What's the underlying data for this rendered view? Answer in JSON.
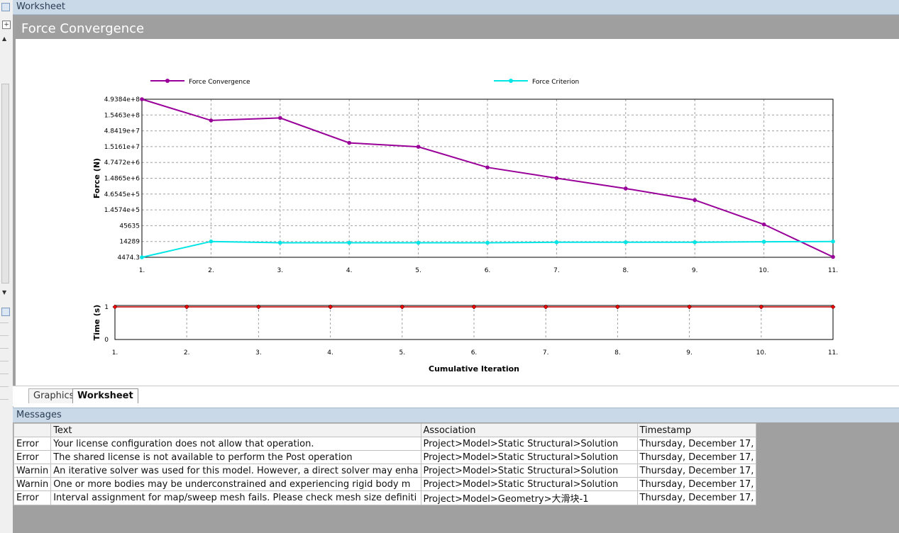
{
  "window": {
    "title": "Worksheet"
  },
  "worksheet": {
    "header": "Force Convergence"
  },
  "chart_data": [
    {
      "type": "line",
      "ylabel": "Force (N)",
      "yscale": "log",
      "y_tick_labels": [
        "4.9384e+8",
        "1.5463e+8",
        "4.8419e+7",
        "1.5161e+7",
        "4.7472e+6",
        "1.4865e+6",
        "4.6545e+5",
        "1.4574e+5",
        "45635",
        "14289",
        "4474.3"
      ],
      "y_ticks": [
        493840000,
        154630000,
        48419000,
        15161000,
        4747200,
        1486500,
        465450,
        145740,
        45635,
        14289,
        4474.3
      ],
      "x": [
        1,
        2,
        3,
        4,
        5,
        6,
        7,
        8,
        9,
        10,
        11
      ],
      "x_tick_labels": [
        "1.",
        "2.",
        "3.",
        "4.",
        "5.",
        "6.",
        "7.",
        "8.",
        "9.",
        "10.",
        "11."
      ],
      "series": [
        {
          "name": "Force Convergence",
          "color": "#990099",
          "values": [
            493840000,
            104000000,
            125000000,
            20000000,
            15000000,
            3300000,
            1500000,
            700000,
            300000,
            50000,
            4600
          ]
        },
        {
          "name": "Force Criterion",
          "color": "#00e5e5",
          "values": [
            4474.3,
            14289,
            13000,
            13000,
            13000,
            13000,
            13500,
            13500,
            13500,
            14000,
            14289
          ]
        }
      ],
      "legend": "top",
      "grid": true
    },
    {
      "type": "line",
      "ylabel": "Time (s)",
      "xlabel": "Cumulative Iteration",
      "y_tick_labels": [
        "1",
        "0"
      ],
      "ylim": [
        0,
        1
      ],
      "x": [
        1,
        2,
        3,
        4,
        5,
        6,
        7,
        8,
        9,
        10,
        11
      ],
      "x_tick_labels": [
        "1.",
        "2.",
        "3.",
        "4.",
        "5.",
        "6.",
        "7.",
        "8.",
        "9.",
        "10.",
        "11."
      ],
      "series": [
        {
          "color": "#cc0000",
          "values": [
            1,
            1,
            1,
            1,
            1,
            1,
            1,
            1,
            1,
            1,
            1
          ]
        }
      ],
      "grid": true
    }
  ],
  "tabs": [
    {
      "label": "Graphics"
    },
    {
      "label": "Worksheet"
    }
  ],
  "messages": {
    "title": "Messages",
    "columns": [
      "Text",
      "Association",
      "Timestamp"
    ],
    "rows": [
      {
        "type": "Error",
        "text": "Your license configuration does not allow that operation.",
        "association": "Project>Model>Static Structural>Solution",
        "timestamp": "Thursday, December 17,"
      },
      {
        "type": "Error",
        "text": "The shared license is not available to perform the Post operation",
        "association": "Project>Model>Static Structural>Solution",
        "timestamp": "Thursday, December 17,"
      },
      {
        "type": "Warnin",
        "text": "An iterative solver was used for this model.  However, a direct solver may enha",
        "association": "Project>Model>Static Structural>Solution",
        "timestamp": "Thursday, December 17,"
      },
      {
        "type": "Warnin",
        "text": "One or more bodies may be underconstrained and experiencing rigid body m",
        "association": "Project>Model>Static Structural>Solution",
        "timestamp": "Thursday, December 17,"
      },
      {
        "type": "Error",
        "text": "Interval assignment for map/sweep mesh fails. Please check mesh size definiti",
        "association": "Project>Model>Geometry>大滑块-1",
        "timestamp": "Thursday, December 17,"
      }
    ]
  }
}
